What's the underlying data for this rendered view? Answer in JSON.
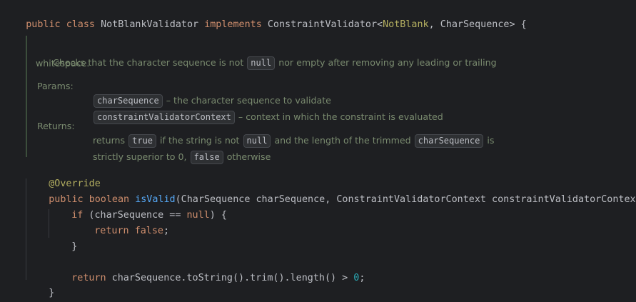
{
  "code": {
    "class_decl": {
      "public": "public",
      "class": "class",
      "name": "NotBlankValidator",
      "implements": "implements",
      "iface": "ConstraintValidator<",
      "generic1": "NotBlank",
      "sep": ", ",
      "generic2": "CharSequence",
      "close": "> {"
    },
    "doc": {
      "summary_a": "Checks that the character sequence is not",
      "summary_code": "null",
      "summary_b": "nor empty after removing any leading or trailing",
      "summary_c": "whitespace.",
      "params_label": "Params:",
      "param1_code": "charSequence",
      "param1_desc": "– the character sequence to validate",
      "param2_code": "constraintValidatorContext",
      "param2_desc": "– context in which the constraint is evaluated",
      "returns_label": "Returns:",
      "ret_a": "returns",
      "ret_code1": "true",
      "ret_b": "if the string is not",
      "ret_code2": "null",
      "ret_c": "and the length of the trimmed",
      "ret_code3": "charSequence",
      "ret_d": "is",
      "ret_e": "strictly superior to 0,",
      "ret_code4": "false",
      "ret_f": "otherwise"
    },
    "override": "@Override",
    "method": {
      "public": "public",
      "boolean": "boolean",
      "name": "isValid",
      "params": "(CharSequence charSequence, ConstraintValidatorContext constraintValidatorContext) {"
    },
    "if_line": {
      "if": "if",
      "cond_a": " (charSequence == ",
      "null": "null",
      "cond_b": ") {"
    },
    "return_false": {
      "return": "return",
      "false": "false",
      "semi": ";"
    },
    "close_if": "}",
    "return_line": {
      "return": "return",
      "expr": " charSequence.toString().trim().length() > ",
      "zero": "0",
      "semi": ";"
    },
    "close_method": "}",
    "close_class": "}"
  }
}
